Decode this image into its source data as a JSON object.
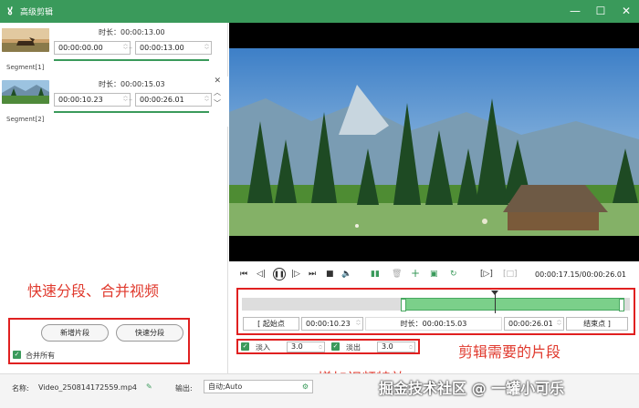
{
  "titlebar": {
    "title": "高级剪辑",
    "minimize": "—",
    "maximize": "☐",
    "close": "✕"
  },
  "segments": [
    {
      "label": "Segment[1]",
      "duration": "时长：00:00:13.00",
      "start": "00:00:00.00",
      "end": "00:00:13.00",
      "progress": 1.0
    },
    {
      "label": "Segment[2]",
      "duration": "时长：00:00:15.03",
      "start": "00:00:10.23",
      "end": "00:00:26.01",
      "progress": 1.0
    }
  ],
  "left_panel": {
    "annotation": "快速分段、合并视频",
    "add_segment_label": "新增片段",
    "quick_split_label": "快速分段",
    "merge_all_label": "合并所有"
  },
  "player": {
    "timecode": "00:00:17.15/00:00:26.01",
    "selection_fraction": [
      0.41,
      1.0
    ],
    "playhead_fraction": 0.655
  },
  "clip_bar": {
    "start_btn": "[ 起始点",
    "start_value": "00:00:10.23",
    "duration_label": "时长：00:00:15.03",
    "end_value": "00:00:26.01",
    "end_btn": "结束点 ]"
  },
  "effects": {
    "fade_in_label": "淡入",
    "fade_in_value": "3.0",
    "fade_out_label": "淡出",
    "fade_out_value": "3.0"
  },
  "annotations": {
    "clip_needed": "剪辑需要的片段",
    "add_effects": "增加视频特效"
  },
  "bottom": {
    "name_label": "名称:",
    "filename": "Video_250814172559.mp4",
    "output_label": "输出:",
    "output_value": "自动;Auto"
  },
  "watermark": "掘金技术社区 @ 一罐小可乐",
  "colors": {
    "accent": "#3a9a5b",
    "annotation": "#e03a2e",
    "selection": "#7bd08a"
  }
}
